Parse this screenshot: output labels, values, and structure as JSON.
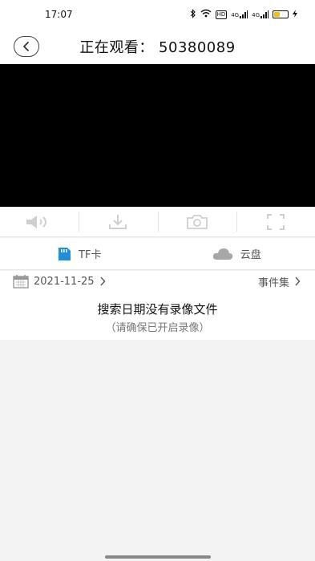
{
  "status_bar": {
    "time": "17:07",
    "network_badge": "HD",
    "signal1": "4G",
    "signal2": "4G",
    "icons": [
      "bluetooth-icon",
      "wifi-icon",
      "hd-badge",
      "signal-icon",
      "signal-icon",
      "battery-icon"
    ]
  },
  "header": {
    "title": "正在观看： 50380089"
  },
  "toolbar": {
    "items": [
      "speaker-icon",
      "download-icon",
      "camera-icon",
      "fullscreen-icon"
    ]
  },
  "storage_tabs": {
    "tf_label": "TF卡",
    "cloud_label": "云盘",
    "accent": "#1f8ee0"
  },
  "date_row": {
    "date": "2021-11-25",
    "events_label": "事件集"
  },
  "empty_state": {
    "message": "搜索日期没有录像文件",
    "hint": "（请确保已开启录像）"
  }
}
